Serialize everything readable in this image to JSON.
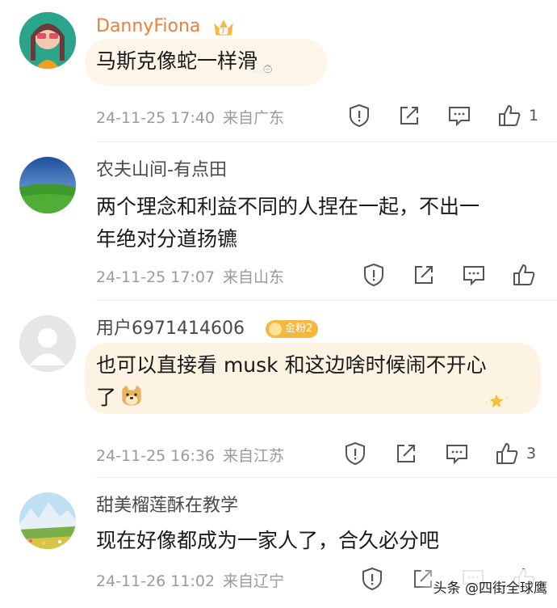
{
  "comments": [
    {
      "username": "DannyFiona",
      "vip_icon": "crown-vip-icon",
      "text_lines": [
        "马斯克像蛇一样滑"
      ],
      "time": "24-11-25 17:40",
      "location": "来自广东",
      "likes": "1",
      "decoration": "duck-sticker"
    },
    {
      "username": "农夫山间-有点田",
      "text_lines": [
        "两个理念和利益不同的人捏在一起，不出一",
        "年绝对分道扬镳"
      ],
      "time": "24-11-25 17:07",
      "location": "来自山东",
      "likes": ""
    },
    {
      "username": "用户6971414606",
      "badge": "金粉2",
      "text_lines": [
        "也可以直接看 musk 和这边啥时候闹不开心",
        "了"
      ],
      "time": "24-11-25 16:36",
      "location": "来自江苏",
      "likes": "3",
      "decoration": "star-sticker"
    },
    {
      "username": "甜美榴莲酥在教学",
      "text_lines": [
        "现在好像都成为一家人了，合久必分吧"
      ],
      "time": "24-11-26 11:02",
      "location": "来自辽宁",
      "likes": ""
    }
  ],
  "watermark": "头条 @四街全球鹰",
  "colors": {
    "vip_name": "#e8823a",
    "meta": "#9a9a9a",
    "bubble1": "#fdf6e8",
    "bubble3": "#fdf3e2",
    "badge": "#f6b73c"
  }
}
